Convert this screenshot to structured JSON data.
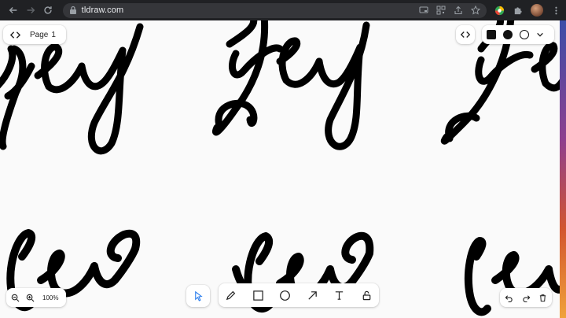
{
  "browser": {
    "url": "tldraw.com",
    "icons": [
      "back-icon",
      "forward-icon",
      "reload-icon",
      "lock-icon",
      "cast-icon",
      "qr-icon",
      "share-icon",
      "star-icon",
      "extension-color-icon",
      "puzzle-icon",
      "avatar",
      "kebab-icon"
    ]
  },
  "menu": {
    "page_label": "Page",
    "page_number": "1"
  },
  "style_panel": {
    "fill_color": "#111111",
    "options": [
      "square-fill",
      "dot-fill",
      "ring-outline",
      "chevron-down-icon"
    ]
  },
  "zoom": {
    "level": "100%"
  },
  "tools": [
    "select-tool",
    "pencil-tool",
    "rectangle-tool",
    "ellipse-tool",
    "arrow-tool",
    "text-tool",
    "lock-tool"
  ],
  "actions": [
    "undo",
    "redo",
    "delete"
  ],
  "colors": {
    "accent_select": "#2f80ed",
    "ink": "#000000",
    "canvas": "#fafafa"
  }
}
